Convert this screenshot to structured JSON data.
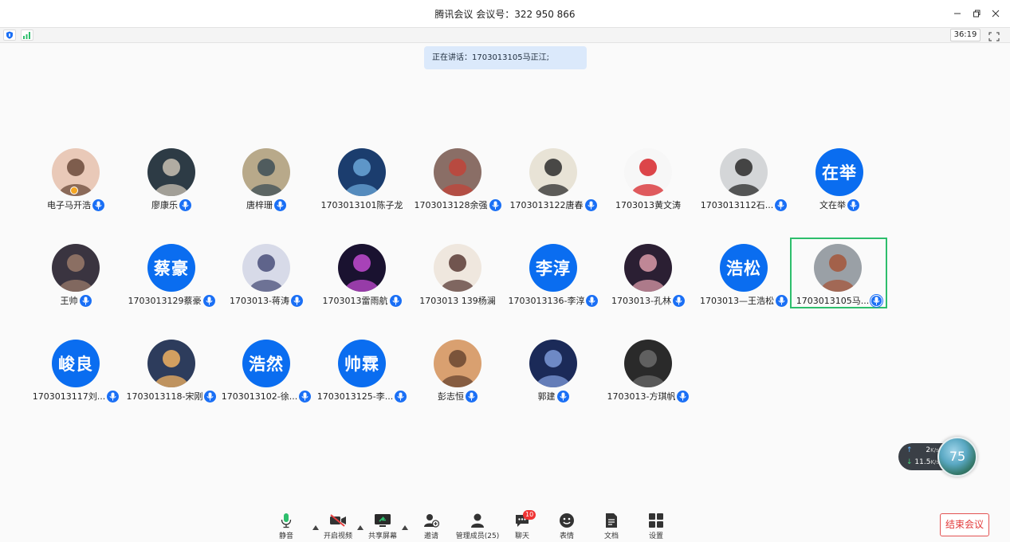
{
  "window": {
    "title": "腾讯会议 会议号：322 950 866",
    "elapsed": "36:19"
  },
  "speaking_banner": "正在讲话：1703013105马正江;",
  "participants": [
    {
      "name": "电子马开浩",
      "avatar_text": "",
      "mic": "on"
    },
    {
      "name": "廖康乐",
      "avatar_text": "",
      "mic": "on"
    },
    {
      "name": "唐梓珊",
      "avatar_text": "",
      "mic": "on"
    },
    {
      "name": "1703013101陈子龙",
      "avatar_text": "",
      "mic": "none"
    },
    {
      "name": "1703013128余强",
      "avatar_text": "",
      "mic": "on"
    },
    {
      "name": "1703013122唐春",
      "avatar_text": "",
      "mic": "on"
    },
    {
      "name": "1703013黄文涛",
      "avatar_text": "",
      "mic": "none"
    },
    {
      "name": "1703013112石...",
      "avatar_text": "",
      "mic": "on"
    },
    {
      "name": "文在举",
      "avatar_text": "在举",
      "mic": "on"
    },
    {
      "name": "王帅",
      "avatar_text": "",
      "mic": "on"
    },
    {
      "name": "1703013129蔡豪",
      "avatar_text": "蔡豪",
      "mic": "on"
    },
    {
      "name": "1703013-蒋涛",
      "avatar_text": "",
      "mic": "on"
    },
    {
      "name": "1703013雷雨航",
      "avatar_text": "",
      "mic": "on"
    },
    {
      "name": "1703013 139杨澜",
      "avatar_text": "",
      "mic": "none"
    },
    {
      "name": "1703013136-李淳",
      "avatar_text": "李淳",
      "mic": "on"
    },
    {
      "name": "1703013-孔林",
      "avatar_text": "",
      "mic": "on"
    },
    {
      "name": "1703013—王浩松",
      "avatar_text": "浩松",
      "mic": "on"
    },
    {
      "name": "1703013105马...",
      "avatar_text": "",
      "mic": "speaking"
    },
    {
      "name": "1703013117刘...",
      "avatar_text": "峻良",
      "mic": "on"
    },
    {
      "name": "1703013118-宋刚",
      "avatar_text": "",
      "mic": "on"
    },
    {
      "name": "1703013102-徐...",
      "avatar_text": "浩然",
      "mic": "on"
    },
    {
      "name": "1703013125-李...",
      "avatar_text": "帅霖",
      "mic": "on"
    },
    {
      "name": "彭志恒",
      "avatar_text": "",
      "mic": "on"
    },
    {
      "name": "郭建",
      "avatar_text": "",
      "mic": "on"
    },
    {
      "name": "1703013-方琪帆",
      "avatar_text": "",
      "mic": "on"
    }
  ],
  "network": {
    "up_value": "2",
    "up_unit": "K/s",
    "down_value": "11.5",
    "down_unit": "K/s",
    "level": "75"
  },
  "toolbar": {
    "mute": "静音",
    "video": "开启视频",
    "share": "共享屏幕",
    "invite": "邀请",
    "members": "管理成员(25)",
    "chat": "聊天",
    "chat_badge": "10",
    "reactions": "表情",
    "docs": "文档",
    "settings": "设置"
  },
  "end_meeting": "结束会议",
  "colors": {
    "accent": "#0a6df0",
    "speaking_border": "#2dbe6c",
    "end_red": "#e23a3a"
  }
}
